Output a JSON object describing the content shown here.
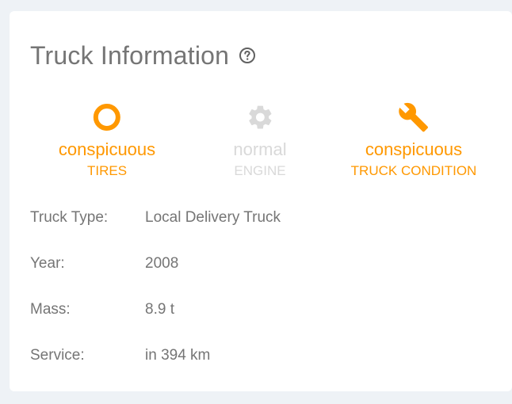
{
  "card": {
    "title": "Truck Information",
    "help_icon": "help-circle-icon"
  },
  "statuses": [
    {
      "icon": "tire-ring-icon",
      "value": "conspicuous",
      "label": "TIRES",
      "state": "alert"
    },
    {
      "icon": "gear-icon",
      "value": "normal",
      "label": "ENGINE",
      "state": "muted"
    },
    {
      "icon": "wrench-icon",
      "value": "conspicuous",
      "label": "TRUCK CONDITION",
      "state": "alert"
    }
  ],
  "info": [
    {
      "key": "Truck Type:",
      "value": "Local Delivery Truck"
    },
    {
      "key": "Year:",
      "value": "2008"
    },
    {
      "key": "Mass:",
      "value": "8.9 t"
    },
    {
      "key": "Service:",
      "value": "in 394 km"
    }
  ],
  "colors": {
    "alert": "#ff9800",
    "muted": "#d9d9d9",
    "text": "#757575",
    "background": "#eef2f6"
  }
}
